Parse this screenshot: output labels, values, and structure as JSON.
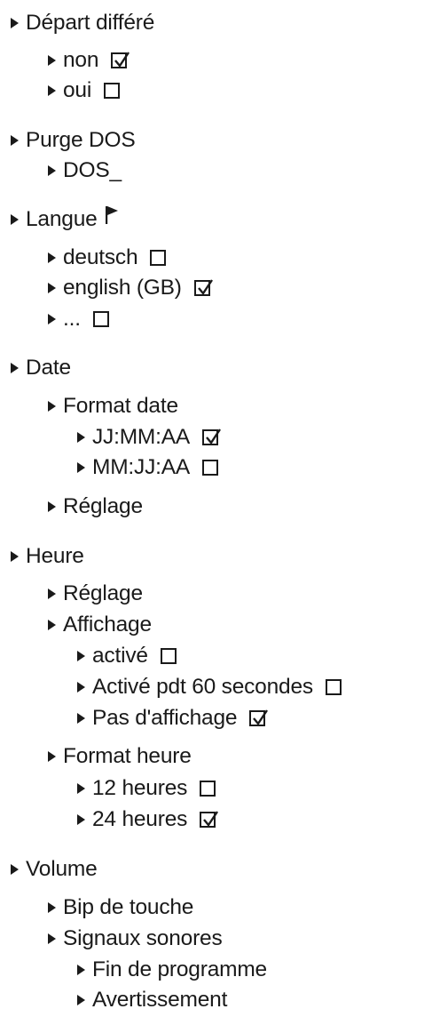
{
  "menu": {
    "items": [
      {
        "label": "Départ différé",
        "level": 0
      },
      {
        "label": "non",
        "level": 1,
        "checked": true
      },
      {
        "label": "oui",
        "level": 1,
        "checked": false
      },
      {
        "label": "Purge DOS",
        "level": 0
      },
      {
        "label": "DOS_",
        "level": 1
      },
      {
        "label": "Langue",
        "level": 0,
        "icon": "flag-icon"
      },
      {
        "label": "deutsch",
        "level": 1,
        "checked": false
      },
      {
        "label": "english (GB)",
        "level": 1,
        "checked": true
      },
      {
        "label": "...",
        "level": 1,
        "checked": false
      },
      {
        "label": "Date",
        "level": 0
      },
      {
        "label": "Format date",
        "level": 1
      },
      {
        "label": "JJ:MM:AA",
        "level": 2,
        "checked": true
      },
      {
        "label": "MM:JJ:AA",
        "level": 2,
        "checked": false
      },
      {
        "label": "Réglage",
        "level": 1
      },
      {
        "label": "Heure",
        "level": 0
      },
      {
        "label": "Réglage",
        "level": 1
      },
      {
        "label": "Affichage",
        "level": 1
      },
      {
        "label": "activé",
        "level": 2,
        "checked": false
      },
      {
        "label": "Activé pdt 60 secondes",
        "level": 2,
        "checked": false
      },
      {
        "label": "Pas d'affichage",
        "level": 2,
        "checked": true
      },
      {
        "label": "Format heure",
        "level": 1
      },
      {
        "label": "12 heures",
        "level": 2,
        "checked": false
      },
      {
        "label": "24 heures",
        "level": 2,
        "checked": true
      },
      {
        "label": "Volume",
        "level": 0
      },
      {
        "label": "Bip de touche",
        "level": 1
      },
      {
        "label": "Signaux sonores",
        "level": 1
      },
      {
        "label": "Fin de programme",
        "level": 2
      },
      {
        "label": "Avertissement",
        "level": 2
      }
    ]
  }
}
